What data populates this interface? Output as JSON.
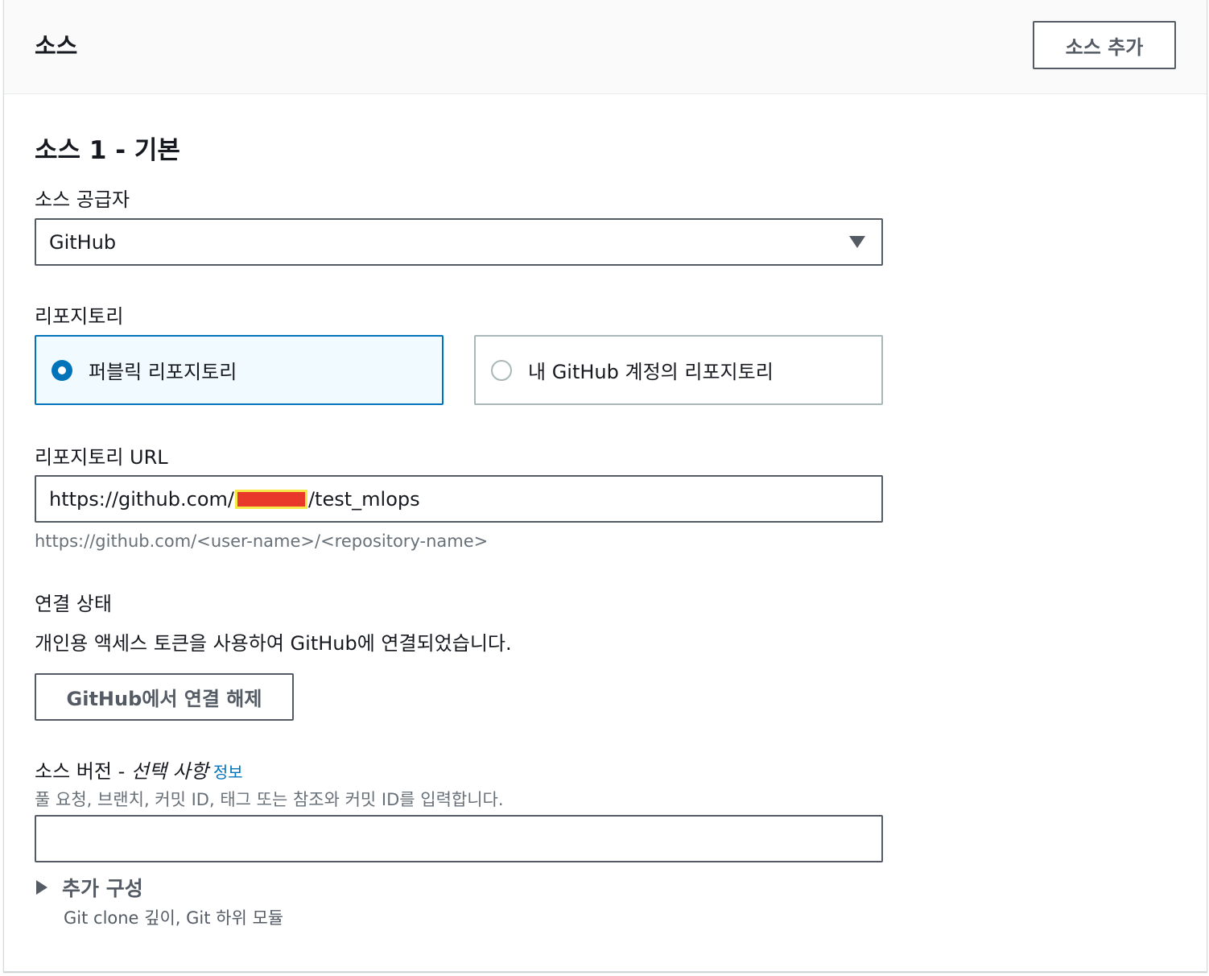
{
  "panel": {
    "title": "소스",
    "add_source_label": "소스 추가"
  },
  "source": {
    "title": "소스 1 - 기본",
    "provider_label": "소스 공급자",
    "provider_value": "GitHub",
    "repository_label": "리포지토리",
    "repository_options": [
      {
        "label": "퍼블릭 리포지토리",
        "selected": true
      },
      {
        "label": "내 GitHub 계정의 리포지토리",
        "selected": false
      }
    ],
    "url_label": "리포지토리 URL",
    "url_prefix": "https://github.com/",
    "url_suffix": "/test_mlops",
    "url_hint": "https://github.com/<user-name>/<repository-name>",
    "connection_label": "연결 상태",
    "connection_text": "개인용 액세스 토큰을 사용하여 GitHub에 연결되었습니다.",
    "disconnect_label": "GitHub에서 연결 해제",
    "version_label": "소스 버전 -",
    "version_optional": "선택 사항",
    "version_info_link": "정보",
    "version_description": "풀 요청, 브랜치, 커밋 ID, 태그 또는 참조와 커밋 ID를 입력합니다.",
    "version_value": "",
    "additional_config_label": "추가 구성",
    "additional_config_desc": "Git clone 깊이, Git 하위 모듈"
  },
  "colors": {
    "accent": "#0073bb",
    "selected_tile_bg": "#f1faff",
    "border_dark": "#545b64",
    "hint_text": "#687078"
  }
}
